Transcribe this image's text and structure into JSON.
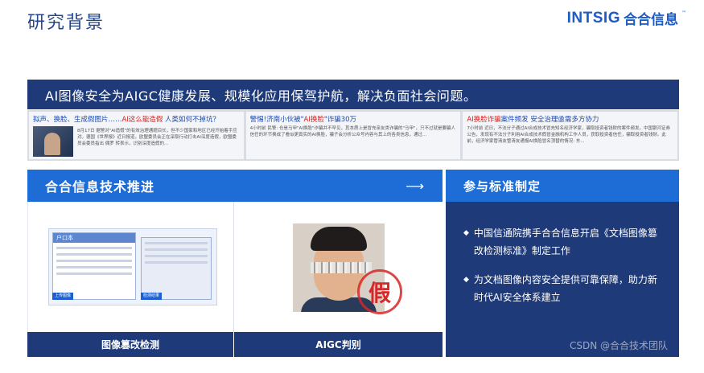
{
  "header": {
    "title": "研究背景",
    "brand_en": "INTSIG",
    "brand_cn": "合合信息",
    "brand_tm": "™"
  },
  "banner": {
    "text": "AI图像安全为AIGC健康发展、规模化应用保驾护航，解决负面社会问题。"
  },
  "news": [
    {
      "title_pre": "拟声、换脸、生成假图片……",
      "title_hl": "AI这么能造假",
      "title_post": " 人类如何不掉坑？",
      "body": "8月17日 据警对\"AI造假\"的有效治理通题目长，但不少国家和地区已经开始着手应对。德国《世界报》近日报道，欧盟委员会正在采取行动打击AI深度造假，欧盟委员会委员指出 偶罗 转表示，识别深度造假的..."
    },
    {
      "title_pre": "警惕!济南小伙被\"",
      "title_hl": "AI换脸",
      "title_post": "\"诈骗30万",
      "body": "4小时前 民警: 仓是马甲\"AI换脸\"诈骗并不罕见，其本质上是冒充亲友类诈骗的\"马甲\"，只不过就是要骗人信任的环节换成了看似更真实的AI换脸，骗子会分析公众号内容与其上的各类信息，通过..."
    },
    {
      "title_pre": "",
      "title_hl": "AI换脸诈骗",
      "title_post": "案件频发 安全治理亟需多方协力",
      "body": "7小时前 近日，不法分子通过AI合成技术冒充知名经济学家，骗取投资者钱财的案件频发。中国银河证券公告，发现有不法分子利用AI合成技术假冒金融机构工作人员，获取投资者信任，骗取投资者钱财。此前，经济学家管清友管清友通报AI换脸冒名顶替的情况: 东..."
    }
  ],
  "tech": {
    "heading": "合合信息技术推进",
    "arrow": "⟶",
    "caption_left": "图像篡改检测",
    "caption_right": "AIGC判别",
    "doc_header": "户口本",
    "doc_tag_left": "上传图像",
    "doc_tag_right": "检测结果",
    "stamp": "假"
  },
  "standard": {
    "heading": "参与标准制定",
    "items": [
      "中国信通院携手合合信息开启《文档图像篡改检测标准》制定工作",
      "为文档图像内容安全提供可靠保障，助力新时代AI安全体系建立"
    ],
    "bullet": "◆"
  },
  "watermark": "CSDN @合合技术团队"
}
